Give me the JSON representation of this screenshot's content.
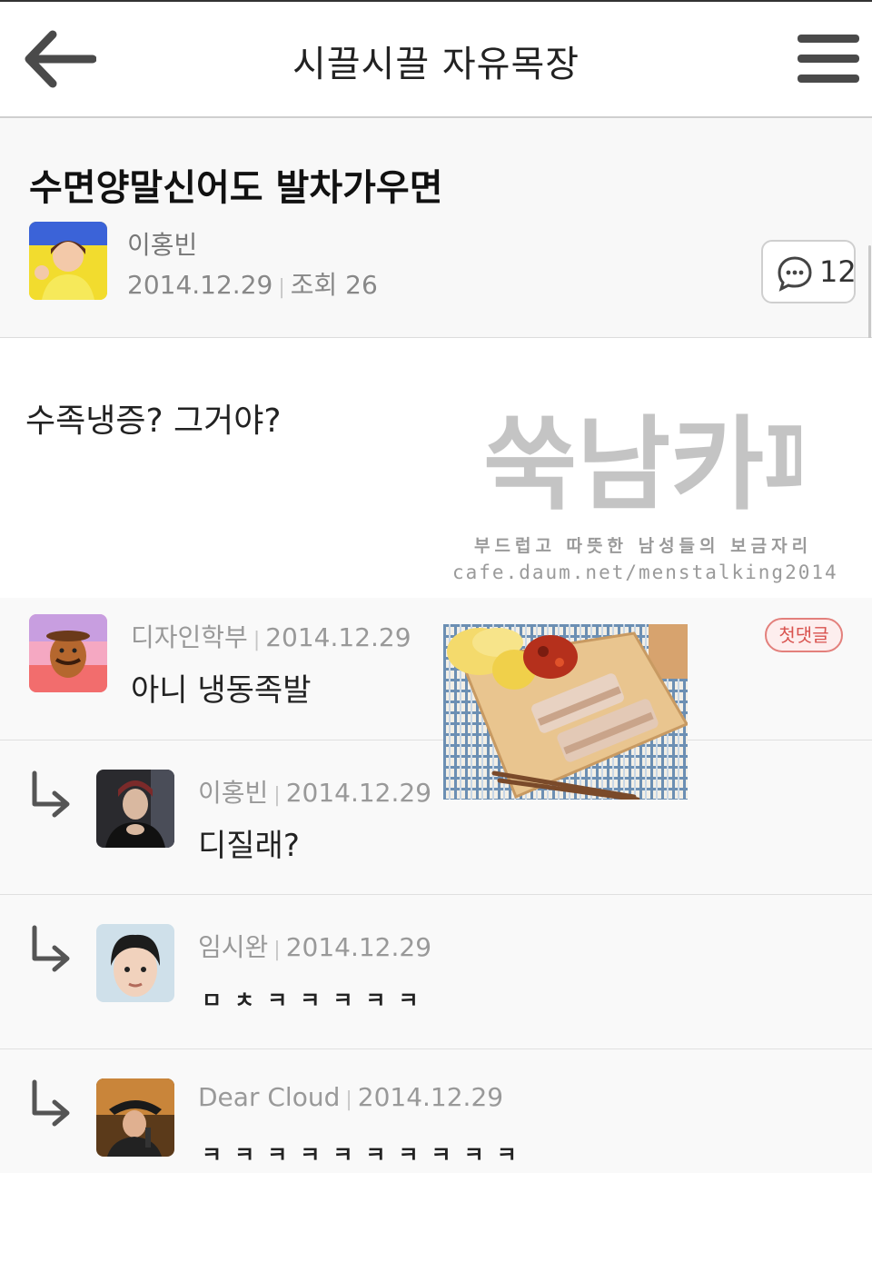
{
  "header": {
    "title": "시끌시끌 자유목장"
  },
  "post": {
    "title": "수면양말신어도 발차가우면",
    "author": "이홍빈",
    "date": "2014.12.29",
    "views_label": "조회 26",
    "comment_count": "12",
    "body": "수족냉증? 그거야?"
  },
  "watermark": {
    "logo_text": "쑥남카페",
    "tagline": "부드럽고 따뜻한 남성들의 보금자리",
    "url": "cafe.daum.net/menstalking2014"
  },
  "comments": [
    {
      "author": "디자인학부",
      "date": "2014.12.29",
      "text": "아니 냉동족발",
      "badge": "첫댓글",
      "reply": false
    },
    {
      "author": "이홍빈",
      "date": "2014.12.29",
      "text": "디질래?",
      "reply": true
    },
    {
      "author": "임시완",
      "date": "2014.12.29",
      "text": "ㅁㅊㅋㅋㅋㅋㅋ",
      "reply": true
    },
    {
      "author": "Dear Cloud",
      "date": "2014.12.29",
      "text": "ㅋㅋㅋㅋㅋㅋㅋㅋㅋㅋ",
      "reply": true
    }
  ],
  "colors": {
    "badge": "#d9534f",
    "meta_text": "#999999",
    "background": "#f9f9f9"
  }
}
